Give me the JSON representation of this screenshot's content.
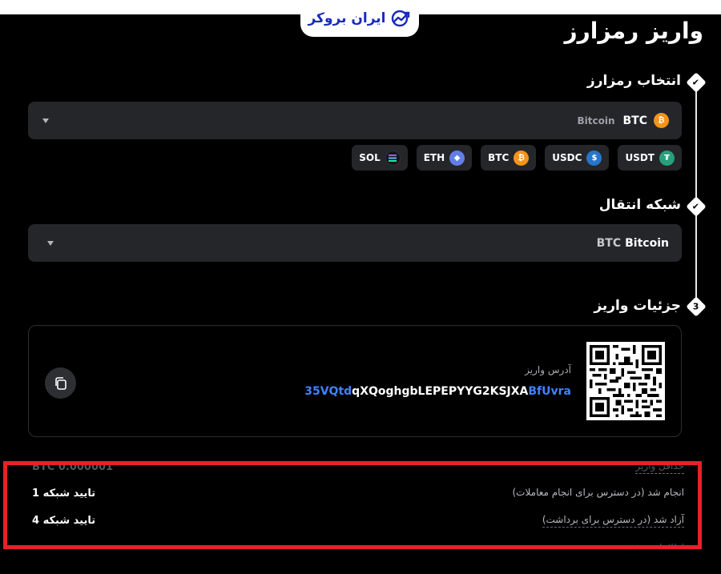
{
  "brand": {
    "name": "ایران بروکر",
    "color": "#1a2bbd"
  },
  "page_title": "واریز رمزارز",
  "steps": [
    {
      "number": "",
      "title": "انتخاب رمزارز",
      "state": "done"
    },
    {
      "number": "",
      "title": "شبکه انتقال",
      "state": "done"
    },
    {
      "number": "3",
      "title": "جزئیات واریز",
      "state": "active"
    }
  ],
  "coin_select": {
    "code": "BTC",
    "name": "Bitcoin",
    "icon": "bitcoin-icon"
  },
  "quick_coins": [
    {
      "code": "SOL",
      "icon": "solana-icon",
      "color": "#14161c"
    },
    {
      "code": "ETH",
      "icon": "ethereum-icon",
      "color": "#627eea"
    },
    {
      "code": "BTC",
      "icon": "bitcoin-icon",
      "color": "#f7931a"
    },
    {
      "code": "USDC",
      "icon": "usdc-icon",
      "color": "#2775ca"
    },
    {
      "code": "USDT",
      "icon": "tether-icon",
      "color": "#26a17b"
    }
  ],
  "network_select": {
    "code": "BTC",
    "name": "Bitcoin"
  },
  "deposit": {
    "address_label": "آدرس واریز",
    "address_start": "35VQtd",
    "address_middle": "qXQoghgbLEPEPYYG2KSJXA",
    "address_end": "BfUvra",
    "highlight_color": "#3f83ff"
  },
  "details": {
    "partial_top_value": "BTC 0.000001",
    "partial_top_label": "حداقل واریز",
    "rows": [
      {
        "label": "انجام شد (در دسترس برای انجام معاملات)",
        "value": "1 تایید شبکه"
      },
      {
        "label": "آزاد شد (در دسترس برای برداشت)",
        "value": "4 تایید شبکه"
      }
    ],
    "partial_bottom": "اطلاعات بیشتر"
  },
  "highlight_frame_color": "#e8202a"
}
